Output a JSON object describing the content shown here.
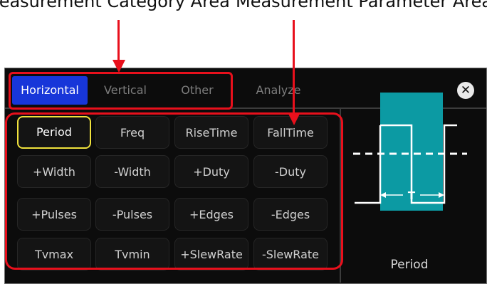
{
  "annotations": {
    "left_label": "Measurement Category Area",
    "right_label": "Measurement Parameter Area"
  },
  "colors": {
    "accent_red": "#e8101c",
    "tab_active": "#1736d9",
    "selected_border": "#f0e23c",
    "waveform_fill": "#0c9aa3",
    "panel_background": "#0c0c0c"
  },
  "tabs": [
    {
      "label": "Horizontal",
      "active": true
    },
    {
      "label": "Vertical",
      "active": false
    },
    {
      "label": "Other",
      "active": false
    },
    {
      "label": "Analyze",
      "active": false
    }
  ],
  "close_icon": "close-icon",
  "measurements": [
    [
      "Period",
      "Freq",
      "RiseTime",
      "FallTime"
    ],
    [
      "+Width",
      "-Width",
      "+Duty",
      "-Duty"
    ],
    [
      "+Pulses",
      "-Pulses",
      "+Edges",
      "-Edges"
    ],
    [
      "Tvmax",
      "Tvmin",
      "+SlewRate",
      "-SlewRate"
    ]
  ],
  "selected_measurement": "Period",
  "preview": {
    "waveform_icon": "square-wave-icon",
    "marker": "T",
    "label": "Period"
  }
}
